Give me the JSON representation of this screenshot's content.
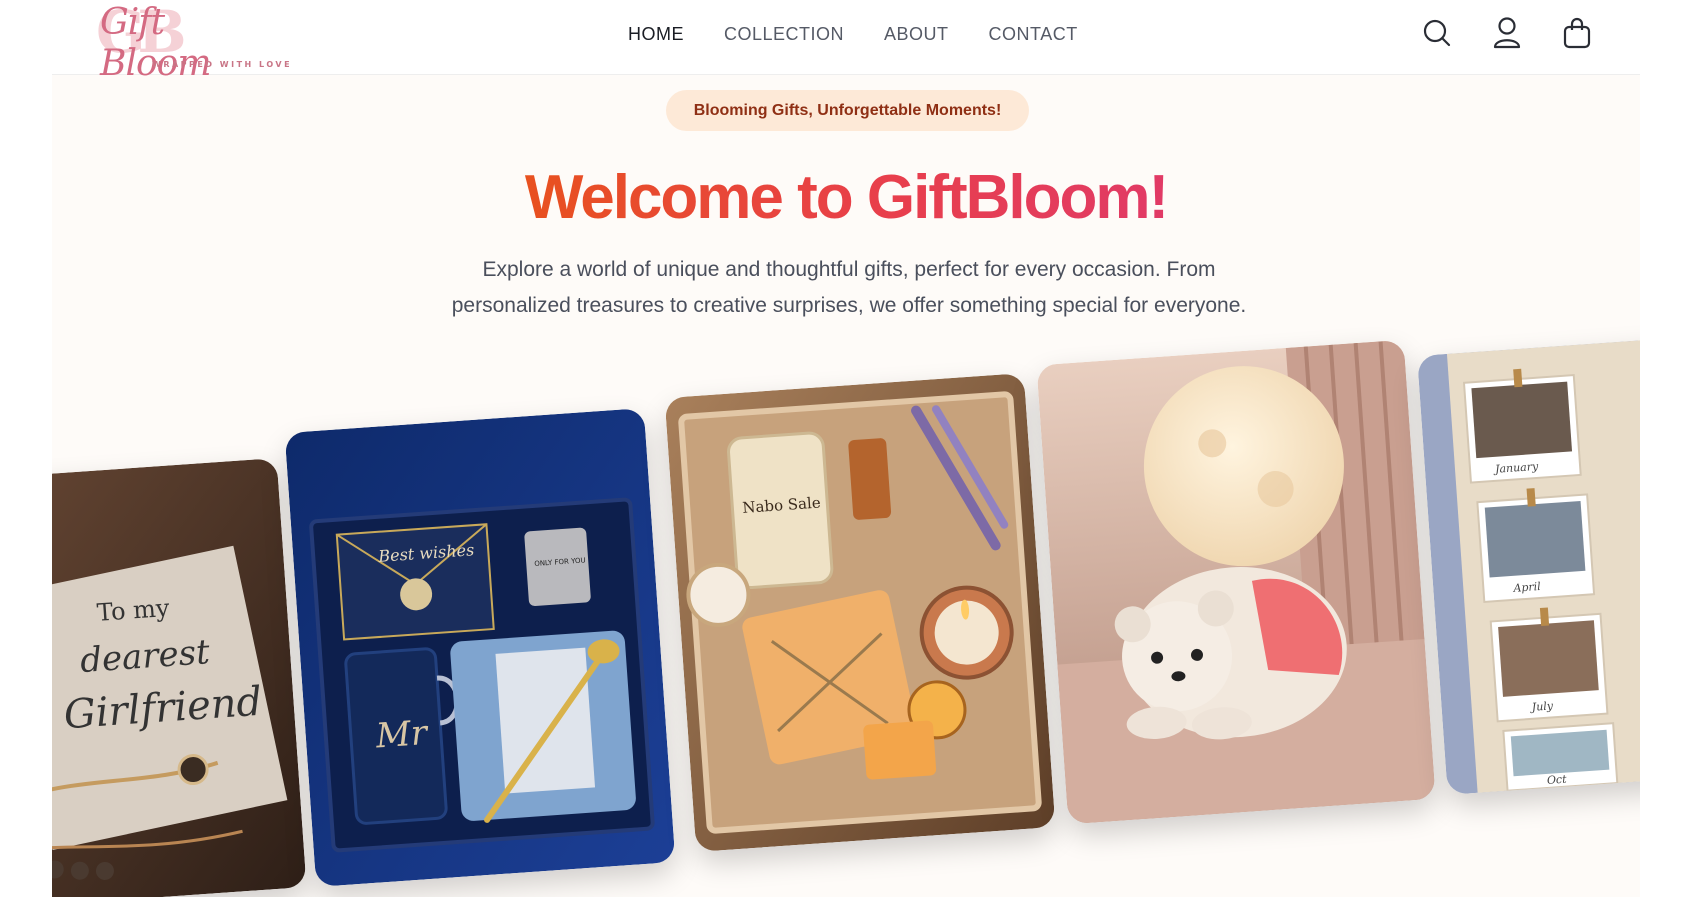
{
  "brand": {
    "monogram": "GB",
    "name": "Gift Bloom",
    "tagline": "WRAPPED WITH LOVE"
  },
  "nav": {
    "items": [
      {
        "label": "HOME",
        "active": true
      },
      {
        "label": "COLLECTION",
        "active": false
      },
      {
        "label": "ABOUT",
        "active": false
      },
      {
        "label": "CONTACT",
        "active": false
      }
    ]
  },
  "header_icons": [
    "search-icon",
    "user-icon",
    "shopping-bag-icon"
  ],
  "hero": {
    "badge": "Blooming Gifts, Unforgettable Moments!",
    "title": "Welcome to GiftBloom!",
    "description": "Explore a world of unique and thoughtful gifts, perfect for every occasion. From personalized treasures to creative surprises, we offer something special for everyone."
  },
  "gallery": {
    "cards": [
      {
        "subject": "dearest-girlfriend-card",
        "card_text": [
          "To my",
          "dearest",
          "Girlfriend"
        ]
      },
      {
        "subject": "navy-gift-box",
        "card_text": [
          "Best wishes",
          "ONLY FOR YOU",
          "Mr"
        ]
      },
      {
        "subject": "soap-candle-box",
        "card_text": [
          "Nabo Sale"
        ]
      },
      {
        "subject": "moon-lamp-bear",
        "card_text": []
      },
      {
        "subject": "photo-calendar",
        "card_text": [
          "January",
          "April",
          "July",
          "Oct"
        ]
      }
    ]
  },
  "colors": {
    "accent_start": "#e8511f",
    "accent_end": "#e13a66",
    "badge_bg": "#fde9d7",
    "badge_text": "#8f2f14",
    "page_bg": "#fefbf8"
  }
}
